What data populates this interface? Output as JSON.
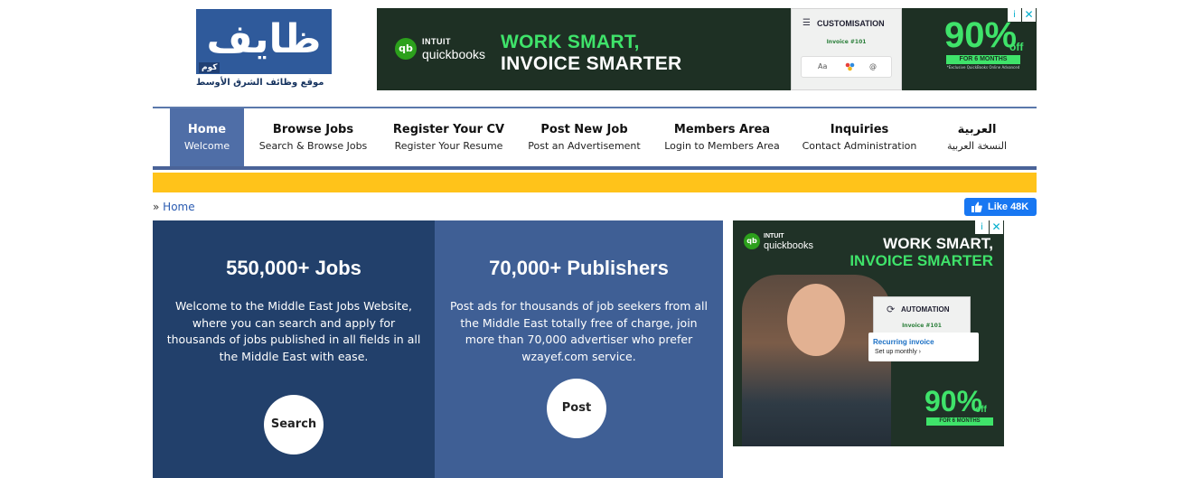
{
  "logo": {
    "arabic_name": "ظايف",
    "com_text": "كوم",
    "tagline": "موقع وظائف الشرق الأوسط"
  },
  "ad_top": {
    "brand_line1": "INTUIT",
    "brand_line2": "quickbooks",
    "logo_text": "qb",
    "headline1": "WORK SMART,",
    "headline2": "INVOICE SMARTER",
    "card_title": "CUSTOMISATION",
    "card_invoice": "Invoice #101",
    "card_opt1": "Aa",
    "card_opt3": "@",
    "percent": "90%",
    "off": "off",
    "band": "FOR 6 MONTHS",
    "fine": "*Exclusive QuickBooks Online Advanced",
    "info_glyph": "i",
    "close_glyph": "✕",
    "accent": "#3fe36a"
  },
  "nav": {
    "items": [
      {
        "title": "Home",
        "subtitle": "Welcome",
        "active": true
      },
      {
        "title": "Browse Jobs",
        "subtitle": "Search & Browse Jobs"
      },
      {
        "title": "Register Your CV",
        "subtitle": "Register Your Resume"
      },
      {
        "title": "Post New Job",
        "subtitle": "Post an Advertisement"
      },
      {
        "title": "Members Area",
        "subtitle": "Login to Members Area"
      },
      {
        "title": "Inquiries",
        "subtitle": "Contact Administration"
      },
      {
        "title": "العربية",
        "subtitle": "النسخة العربية"
      }
    ]
  },
  "breadcrumb": {
    "separator": "»",
    "home": "Home"
  },
  "fb_like": {
    "label": "Like 48K"
  },
  "hero": {
    "jobs": {
      "title": "550,000+ Jobs",
      "text": "Welcome to the Middle East Jobs Website, where you can search and apply for thousands of jobs published in all fields in all the Middle East with ease.",
      "button": "Search"
    },
    "publishers": {
      "title": "70,000+ Publishers",
      "text": "Post ads for thousands of job seekers from all the Middle East totally free of charge, join more than 70,000 advertiser who prefer wzayef.com service.",
      "button": "Post"
    }
  },
  "ad_side": {
    "logo_text": "qb",
    "brand_line1": "INTUIT",
    "brand_line2": "quickbooks",
    "headline1": "WORK SMART,",
    "headline2": "INVOICE SMARTER",
    "card_title": "AUTOMATION",
    "card_invoice": "Invoice #101",
    "rec_title": "Recurring invoice",
    "rec_sub": "Set up monthly ›",
    "percent": "90%",
    "off": "off",
    "band": "FOR 6 MONTHS"
  },
  "colors": {
    "nav_active": "#4f6ea7",
    "yellow_bar": "#ffc31a",
    "panel_left": "#22406b",
    "panel_right": "#3f5f95",
    "facebook": "#1877f2"
  }
}
